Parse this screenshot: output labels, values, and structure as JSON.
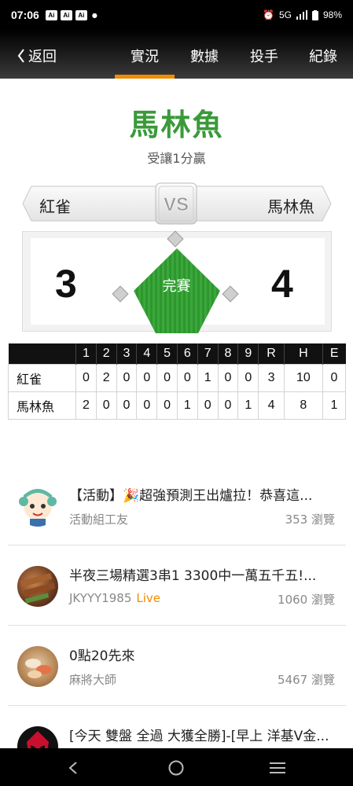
{
  "status_bar": {
    "time": "07:06",
    "apps": [
      "Ai",
      "Ai",
      "Ai"
    ],
    "network": "5G",
    "battery": "98%"
  },
  "header": {
    "back_label": "返回",
    "tabs": [
      {
        "label": "實況",
        "active": true
      },
      {
        "label": "數據",
        "active": false
      },
      {
        "label": "投手",
        "active": false
      },
      {
        "label": "紀錄",
        "active": false
      }
    ]
  },
  "game": {
    "winner": "馬林魚",
    "handicap": "受讓1分贏",
    "away_team": "紅雀",
    "home_team": "馬林魚",
    "vs": "VS",
    "away_score": "3",
    "home_score": "4",
    "state": "完賽"
  },
  "boxscore": {
    "columns": [
      "1",
      "2",
      "3",
      "4",
      "5",
      "6",
      "7",
      "8",
      "9",
      "R",
      "H",
      "E"
    ],
    "rows": [
      {
        "team": "紅雀",
        "values": [
          "0",
          "2",
          "0",
          "0",
          "0",
          "0",
          "1",
          "0",
          "0",
          "3",
          "10",
          "0"
        ]
      },
      {
        "team": "馬林魚",
        "values": [
          "2",
          "0",
          "0",
          "0",
          "0",
          "1",
          "0",
          "0",
          "1",
          "4",
          "8",
          "1"
        ]
      }
    ]
  },
  "posts": [
    {
      "title": "【活動】🎉超強預測王出爐拉！恭喜這...",
      "author": "活動組工友",
      "live": "",
      "views": "353 瀏覽",
      "avatar": "cartoon-avatar"
    },
    {
      "title": "半夜三場精選3串1 3300中一萬五千五!...",
      "author": "JKYYY1985",
      "live": "Live",
      "views": "1060 瀏覽",
      "avatar": "food-photo-avatar"
    },
    {
      "title": "0點20先來",
      "author": "麻將大師",
      "live": "",
      "views": "5467 瀏覽",
      "avatar": "sushi-photo-avatar"
    },
    {
      "title": "[今天 雙盤 全過 大獲全勝]-[早上 洋基V金...",
      "author": "",
      "live": "",
      "views": "",
      "avatar": "red-mask-avatar"
    }
  ],
  "colors": {
    "accent": "#f08c00",
    "winner": "#3a9a3a",
    "field": "#3aa83a"
  }
}
